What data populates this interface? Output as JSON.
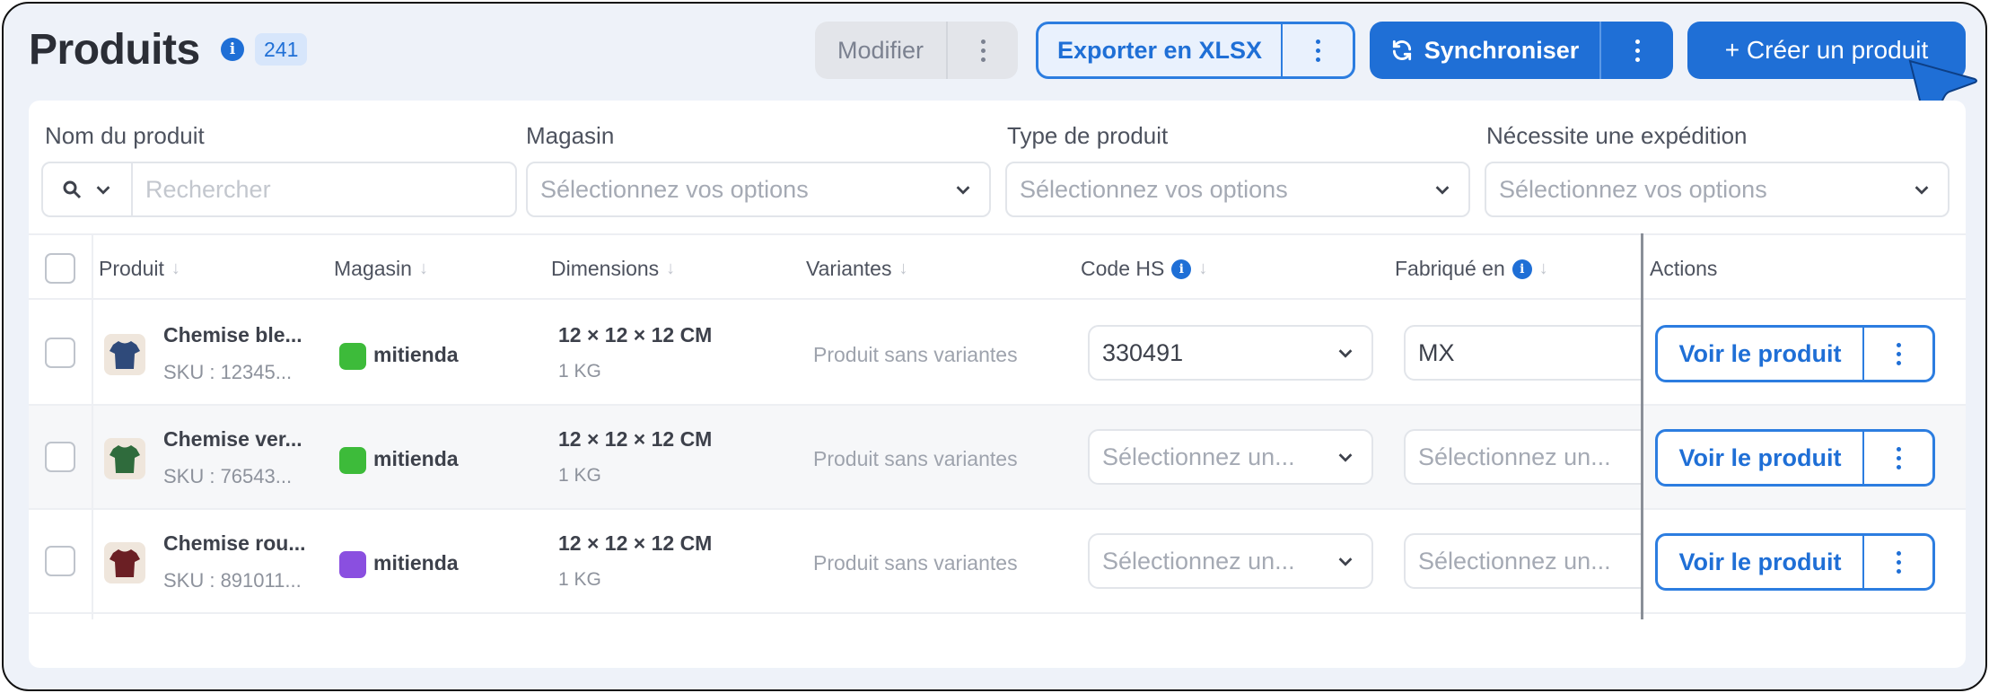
{
  "header": {
    "title": "Produits",
    "count": "241",
    "modify_label": "Modifier",
    "export_label": "Exporter en XLSX",
    "sync_label": "Synchroniser",
    "create_label": "+ Créer un produit"
  },
  "filters": {
    "name_label": "Nom du produit",
    "search_placeholder": "Rechercher",
    "store_label": "Magasin",
    "store_placeholder": "Sélectionnez vos options",
    "type_label": "Type de produit",
    "type_placeholder": "Sélectionnez vos options",
    "shipping_label": "Nécessite une expédition",
    "shipping_placeholder": "Sélectionnez vos options"
  },
  "columns": {
    "product": "Produit",
    "store": "Magasin",
    "dimensions": "Dimensions",
    "variants": "Variantes",
    "hs_code": "Code HS",
    "origin": "Fabriqué en",
    "actions": "Actions"
  },
  "rows": [
    {
      "name": "Chemise ble...",
      "sku": "SKU : 12345...",
      "store": "mitienda",
      "store_color": "#3dbb3a",
      "shirt_color": "#2f4a7a",
      "dimensions": "12 × 12 × 12 CM",
      "weight": "1 KG",
      "variants": "Produit sans variantes",
      "hs_code": "330491",
      "origin": "MX",
      "action_label": "Voir le produit"
    },
    {
      "name": "Chemise ver...",
      "sku": "SKU : 76543...",
      "store": "mitienda",
      "store_color": "#3dbb3a",
      "shirt_color": "#2f6b3c",
      "dimensions": "12 × 12 × 12 CM",
      "weight": "1 KG",
      "variants": "Produit sans variantes",
      "hs_code": "Sélectionnez un...",
      "origin": "Sélectionnez un...",
      "action_label": "Voir le produit"
    },
    {
      "name": "Chemise rou...",
      "sku": "SKU : 891011...",
      "store": "mitienda",
      "store_color": "#8a4fe0",
      "shirt_color": "#6b1f24",
      "dimensions": "12 × 12 × 12 CM",
      "weight": "1 KG",
      "variants": "Produit sans variantes",
      "hs_code": "Sélectionnez un...",
      "origin": "Sélectionnez un...",
      "action_label": "Voir le produit"
    }
  ],
  "colors": {
    "accent": "#1f6fd6",
    "background": "#eef2f9"
  }
}
